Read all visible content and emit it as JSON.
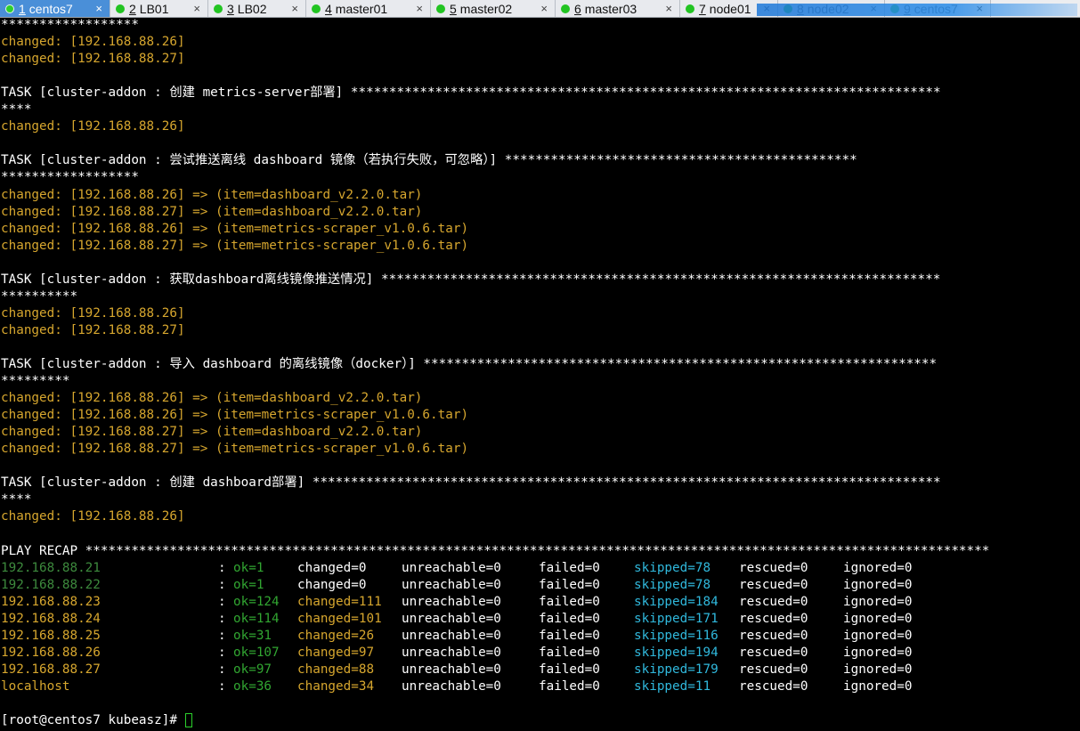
{
  "tabs": [
    {
      "num": "1",
      "label": "centos7",
      "active": true
    },
    {
      "num": "2",
      "label": "LB01"
    },
    {
      "num": "3",
      "label": "LB02"
    },
    {
      "num": "4",
      "label": "master01"
    },
    {
      "num": "5",
      "label": "master02"
    },
    {
      "num": "6",
      "label": "master03"
    },
    {
      "num": "7",
      "label": "node01"
    },
    {
      "num": "8",
      "label": "node02"
    },
    {
      "num": "9",
      "label": "centos7"
    }
  ],
  "terminal": {
    "lines": [
      {
        "text": "******************",
        "color": "white"
      },
      {
        "text": "changed: [192.168.88.26]",
        "color": "orange"
      },
      {
        "text": "changed: [192.168.88.27]",
        "color": "orange"
      },
      {
        "text": "",
        "color": "white"
      },
      {
        "text": "TASK [cluster-addon : 创建 metrics-server部署] *****************************************************************************",
        "color": "white"
      },
      {
        "text": "****",
        "color": "white"
      },
      {
        "text": "changed: [192.168.88.26]",
        "color": "orange"
      },
      {
        "text": "",
        "color": "white"
      },
      {
        "text": "TASK [cluster-addon : 尝试推送离线 dashboard 镜像（若执行失败，可忽略）] **********************************************",
        "color": "white"
      },
      {
        "text": "******************",
        "color": "white"
      },
      {
        "text": "changed: [192.168.88.26] => (item=dashboard_v2.2.0.tar)",
        "color": "orange"
      },
      {
        "text": "changed: [192.168.88.27] => (item=dashboard_v2.2.0.tar)",
        "color": "orange"
      },
      {
        "text": "changed: [192.168.88.26] => (item=metrics-scraper_v1.0.6.tar)",
        "color": "orange"
      },
      {
        "text": "changed: [192.168.88.27] => (item=metrics-scraper_v1.0.6.tar)",
        "color": "orange"
      },
      {
        "text": "",
        "color": "white"
      },
      {
        "text": "TASK [cluster-addon : 获取dashboard离线镜像推送情况] *************************************************************************",
        "color": "white"
      },
      {
        "text": "**********",
        "color": "white"
      },
      {
        "text": "changed: [192.168.88.26]",
        "color": "orange"
      },
      {
        "text": "changed: [192.168.88.27]",
        "color": "orange"
      },
      {
        "text": "",
        "color": "white"
      },
      {
        "text": "TASK [cluster-addon : 导入 dashboard 的离线镜像（docker）] *******************************************************************",
        "color": "white"
      },
      {
        "text": "*********",
        "color": "white"
      },
      {
        "text": "changed: [192.168.88.26] => (item=dashboard_v2.2.0.tar)",
        "color": "orange"
      },
      {
        "text": "changed: [192.168.88.26] => (item=metrics-scraper_v1.0.6.tar)",
        "color": "orange"
      },
      {
        "text": "changed: [192.168.88.27] => (item=dashboard_v2.2.0.tar)",
        "color": "orange"
      },
      {
        "text": "changed: [192.168.88.27] => (item=metrics-scraper_v1.0.6.tar)",
        "color": "orange"
      },
      {
        "text": "",
        "color": "white"
      },
      {
        "text": "TASK [cluster-addon : 创建 dashboard部署] **********************************************************************************",
        "color": "white"
      },
      {
        "text": "****",
        "color": "white"
      },
      {
        "text": "changed: [192.168.88.26]",
        "color": "orange"
      },
      {
        "text": "",
        "color": "white"
      },
      {
        "text": "PLAY RECAP **********************************************************************************************************************",
        "color": "white"
      }
    ],
    "recap": [
      {
        "host": "192.168.88.21",
        "host_color": "dgreen",
        "ok": "ok=1",
        "changed": "changed=0",
        "changed_color": "white",
        "unreachable": "unreachable=0",
        "failed": "failed=0",
        "skipped": "skipped=78",
        "rescued": "rescued=0",
        "ignored": "ignored=0"
      },
      {
        "host": "192.168.88.22",
        "host_color": "dgreen",
        "ok": "ok=1",
        "changed": "changed=0",
        "changed_color": "white",
        "unreachable": "unreachable=0",
        "failed": "failed=0",
        "skipped": "skipped=78",
        "rescued": "rescued=0",
        "ignored": "ignored=0"
      },
      {
        "host": "192.168.88.23",
        "host_color": "orange",
        "ok": "ok=124",
        "changed": "changed=111",
        "changed_color": "orange",
        "unreachable": "unreachable=0",
        "failed": "failed=0",
        "skipped": "skipped=184",
        "rescued": "rescued=0",
        "ignored": "ignored=0"
      },
      {
        "host": "192.168.88.24",
        "host_color": "orange",
        "ok": "ok=114",
        "changed": "changed=101",
        "changed_color": "orange",
        "unreachable": "unreachable=0",
        "failed": "failed=0",
        "skipped": "skipped=171",
        "rescued": "rescued=0",
        "ignored": "ignored=0"
      },
      {
        "host": "192.168.88.25",
        "host_color": "orange",
        "ok": "ok=31",
        "changed": "changed=26",
        "changed_color": "orange",
        "unreachable": "unreachable=0",
        "failed": "failed=0",
        "skipped": "skipped=116",
        "rescued": "rescued=0",
        "ignored": "ignored=0"
      },
      {
        "host": "192.168.88.26",
        "host_color": "orange",
        "ok": "ok=107",
        "changed": "changed=97",
        "changed_color": "orange",
        "unreachable": "unreachable=0",
        "failed": "failed=0",
        "skipped": "skipped=194",
        "rescued": "rescued=0",
        "ignored": "ignored=0"
      },
      {
        "host": "192.168.88.27",
        "host_color": "orange",
        "ok": "ok=97",
        "changed": "changed=88",
        "changed_color": "orange",
        "unreachable": "unreachable=0",
        "failed": "failed=0",
        "skipped": "skipped=179",
        "rescued": "rescued=0",
        "ignored": "ignored=0"
      },
      {
        "host": "localhost",
        "host_color": "orange",
        "ok": "ok=36",
        "changed": "changed=34",
        "changed_color": "orange",
        "unreachable": "unreachable=0",
        "failed": "failed=0",
        "skipped": "skipped=11",
        "rescued": "rescued=0",
        "ignored": "ignored=0"
      }
    ],
    "recap_separator": ":",
    "prompt": "[root@centos7 kubeasz]# "
  },
  "colors": {
    "background": "#000000",
    "orange": "#d6a62e",
    "green": "#31a531",
    "dgreen": "#3d8a3d",
    "cyan": "#30b8dc",
    "white": "#ffffff",
    "active_tab": "#4a8fd8"
  },
  "icons": {
    "tab_status": "green-dot-icon",
    "tab_close": "close-icon"
  }
}
